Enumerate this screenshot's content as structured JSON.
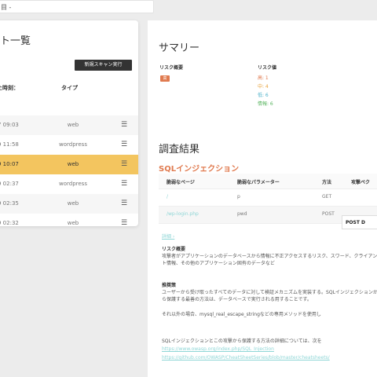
{
  "topbar": {
    "selector_value": "目 -"
  },
  "left_panel": {
    "title": "ト一覧",
    "scan_button": "新規スキャン実行",
    "headers": {
      "date": "た時刻：",
      "type": "タイプ"
    },
    "rows": [
      {
        "date": "7 09:03",
        "type": "web"
      },
      {
        "date": "9 11:58",
        "type": "wordpress"
      },
      {
        "date": "9 10:07",
        "type": "web"
      },
      {
        "date": "9 02:37",
        "type": "wordpress"
      },
      {
        "date": "9 02:35",
        "type": "web"
      },
      {
        "date": "9 02:32",
        "type": "web"
      }
    ],
    "selected_index": 2
  },
  "summary": {
    "title": "サマリー",
    "risk_overview_label": "リスク概要",
    "risk_badge": "高",
    "risk_count_label": "リスク値",
    "counts": {
      "high": "高: 1",
      "medium": "中: 4",
      "low": "低: 6",
      "info": "情報: 6"
    }
  },
  "results": {
    "title": "調査結果",
    "vuln_title": "SQLインジェクション",
    "table_headers": [
      "脆弱なページ",
      "脆弱なパラメーター",
      "方法",
      "攻撃ベク"
    ],
    "table_rows": [
      {
        "page": "/",
        "param": "p",
        "method": "GET"
      },
      {
        "page": "/wp-login.php",
        "param": "pwd",
        "method": "POST"
      }
    ],
    "post_label": "POST D",
    "detail_link": "詳細 ›",
    "risk_heading": "リスク概要",
    "risk_text": "攻撃者がアプリケーションのデータベースから情報に不正アクセスするリスク、スワード、クライアント情報、その他のアプリケーション固有のデータなど",
    "fix_heading": "推奨策",
    "fix_text_1": "ユーザーから受け取ったすべてのデータに対して検証メカニズムを実装する。SQLインジェクションから保護する最善の方法は、データベースで実行される用することです。",
    "fix_text_2": "それ以外の場合、mysql_real_escape_stringなどの専用メソッドを使用し",
    "more_text": "SQLインジェクションとこの攻撃から保護する方法の詳細については、次を",
    "link_1": "https://www.owasp.org/index.php/SQL_Injection",
    "link_2": "https://github.com/OWASP/CheatSheetSeries/blob/master/cheatsheets/"
  },
  "colors": {
    "accent": "#e07a4f",
    "selected_row": "#f3c55f",
    "link": "#8fd6d6"
  }
}
